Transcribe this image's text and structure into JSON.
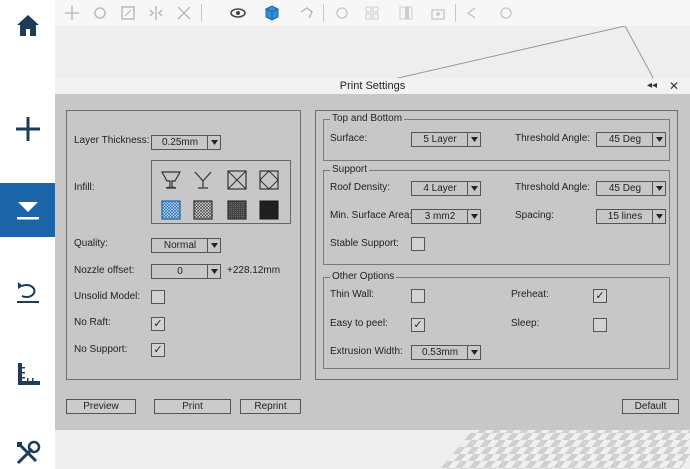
{
  "sidebar": {
    "items": [
      {
        "name": "home-icon",
        "active": false
      },
      {
        "name": "add-icon",
        "active": false
      },
      {
        "name": "print-icon",
        "active": true
      },
      {
        "name": "rotate-icon",
        "active": false
      },
      {
        "name": "measure-icon",
        "active": false
      },
      {
        "name": "tools-icon",
        "active": false
      }
    ]
  },
  "toolbar": {
    "icons": [
      "move-icon",
      "rotate-tool-icon",
      "scale-icon",
      "mirror-icon",
      "cut-icon",
      "view-icon",
      "cube-icon",
      "undo-arrow-icon",
      "object-icon",
      "grid-icon",
      "layout-icon",
      "camera-icon",
      "back-icon",
      "refresh-icon"
    ]
  },
  "dialog": {
    "title": "Print Settings",
    "collapse_glyph": "◂◂",
    "close_glyph": "✕",
    "left": {
      "layer_thickness_label": "Layer Thickness:",
      "layer_thickness_value": "0.25mm",
      "infill_label": "Infill:",
      "infill_icons": [
        "infill-hollow-icon",
        "infill-shell-icon",
        "infill-cross-icon",
        "infill-diamond-icon",
        "infill-fine-icon",
        "infill-medium-icon",
        "infill-dense-icon",
        "infill-solid-icon"
      ],
      "infill_selected": 4,
      "quality_label": "Quality:",
      "quality_value": "Normal",
      "nozzle_offset_label": "Nozzle offset:",
      "nozzle_offset_value": "0",
      "nozzle_offset_extra": "+228.12mm",
      "unsolid_model_label": "Unsolid Model:",
      "unsolid_model_checked": false,
      "no_raft_label": "No Raft:",
      "no_raft_checked": true,
      "no_support_label": "No Support:",
      "no_support_checked": true
    },
    "top_bottom": {
      "title": "Top and Bottom",
      "surface_label": "Surface:",
      "surface_value": "5 Layer",
      "threshold_label": "Threshold Angle:",
      "threshold_value": "45 Deg"
    },
    "support": {
      "title": "Support",
      "roof_density_label": "Roof Density:",
      "roof_density_value": "4 Layer",
      "threshold_label": "Threshold Angle:",
      "threshold_value": "45 Deg",
      "min_surface_label": "Min. Surface Area:",
      "min_surface_value": "3 mm2",
      "spacing_label": "Spacing:",
      "spacing_value": "15 lines",
      "stable_support_label": "Stable Support:",
      "stable_support_checked": false
    },
    "other": {
      "title": "Other Options",
      "thin_wall_label": "Thin Wall:",
      "thin_wall_checked": false,
      "preheat_label": "Preheat:",
      "preheat_checked": true,
      "easy_peel_label": "Easy to peel:",
      "easy_peel_checked": true,
      "sleep_label": "Sleep:",
      "sleep_checked": false,
      "extrusion_width_label": "Extrusion Width:",
      "extrusion_width_value": "0.53mm"
    },
    "buttons": {
      "preview": "Preview",
      "print": "Print",
      "reprint": "Reprint",
      "default": "Default"
    }
  },
  "colors": {
    "accent": "#1b64a8",
    "dialog_bg": "#c7c7c7",
    "cube_blue": "#2f8fd8"
  }
}
